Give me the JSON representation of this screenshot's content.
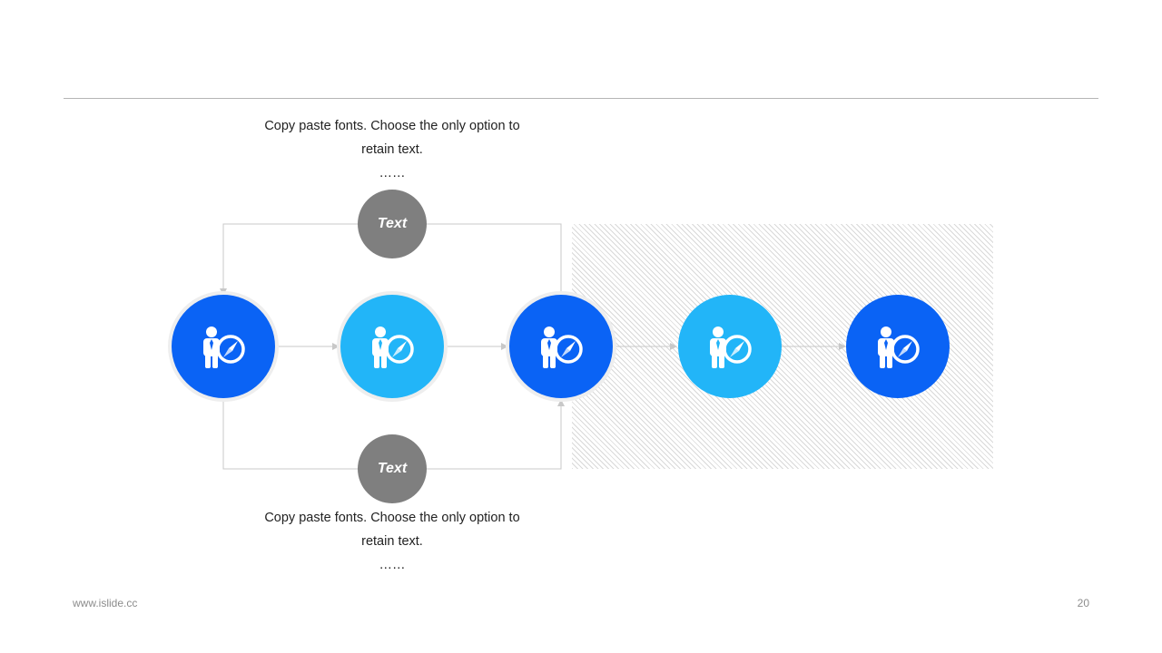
{
  "colors": {
    "dark_blue": "#0a63f5",
    "light_blue": "#22b5f8",
    "gray_circle": "#7f7f7f",
    "connector": "#c8c8c8"
  },
  "top_caption": {
    "line1": "Copy paste fonts. Choose the only option to",
    "line2": "retain text.",
    "dots": "……"
  },
  "bottom_caption": {
    "line1": "Copy paste fonts. Choose the only option to",
    "line2": "retain text.",
    "dots": "……"
  },
  "top_label": "Text",
  "bottom_label": "Text",
  "nodes": [
    {
      "icon": "businessman-compass-icon",
      "color": "dark_blue"
    },
    {
      "icon": "businessman-compass-icon",
      "color": "light_blue"
    },
    {
      "icon": "businessman-compass-icon",
      "color": "dark_blue"
    },
    {
      "icon": "businessman-compass-icon",
      "color": "light_blue"
    },
    {
      "icon": "businessman-compass-icon",
      "color": "dark_blue"
    }
  ],
  "footer": {
    "website": "www.islide.cc",
    "page_number": "20"
  }
}
